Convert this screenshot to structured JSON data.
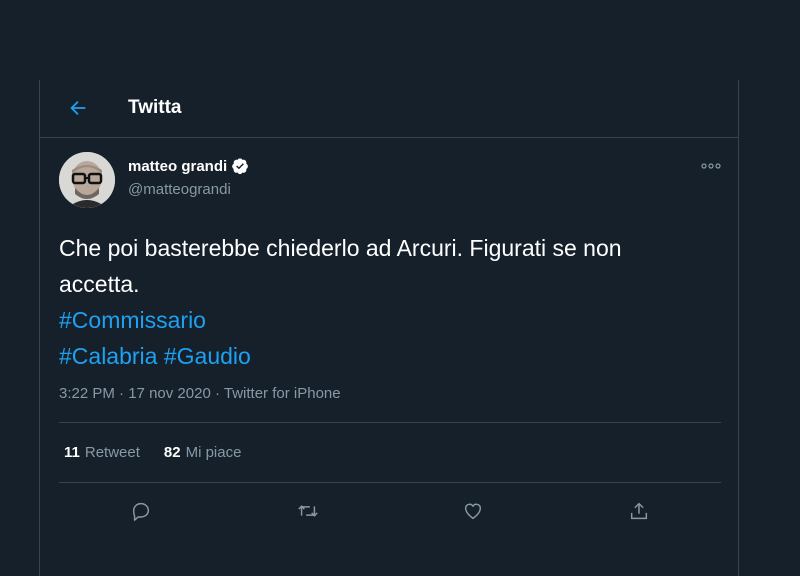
{
  "header": {
    "title": "Twitta",
    "back_icon": "arrow-left-icon"
  },
  "tweet": {
    "author_name": "matteo grandi",
    "author_handle": "@matteograndi",
    "verified": true,
    "text_lines": [
      "Che poi basterebbe chiederlo ad Arcuri. Figurati se non",
      "accetta."
    ],
    "hashtags": [
      "#Commissario",
      "#Calabria",
      "#Gaudio"
    ],
    "time": "3:22 PM",
    "date": "17 nov 2020",
    "separator": "·",
    "source": "Twitter for iPhone",
    "retweet_count": "11",
    "retweet_label": "Retweet",
    "like_count": "82",
    "like_label": "Mi piace"
  },
  "actions": [
    "reply-icon",
    "retweet-icon",
    "like-icon",
    "share-icon"
  ],
  "colors": {
    "background": "#15202b",
    "border": "#38444d",
    "accent": "#1da1f2",
    "secondary_text": "#8899a6"
  }
}
